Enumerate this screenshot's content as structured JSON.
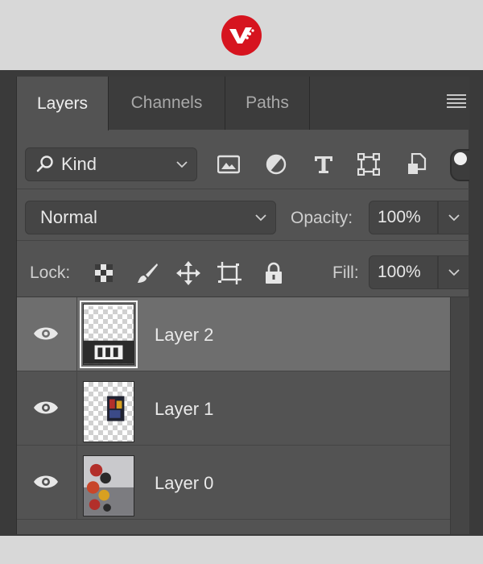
{
  "tabs": [
    {
      "label": "Layers",
      "active": true
    },
    {
      "label": "Channels",
      "active": false
    },
    {
      "label": "Paths",
      "active": false
    }
  ],
  "filter": {
    "kind_label": "Kind",
    "buttons": [
      "image-filter-icon",
      "adjustment-filter-icon",
      "type-filter-icon",
      "shape-filter-icon",
      "smart-object-filter-icon"
    ]
  },
  "blend": {
    "mode": "Normal",
    "opacity_label": "Opacity:",
    "opacity_value": "100%"
  },
  "lock": {
    "label": "Lock:",
    "fill_label": "Fill:",
    "fill_value": "100%",
    "buttons": [
      "lock-transparent-pixels-icon",
      "lock-image-pixels-icon",
      "lock-position-icon",
      "lock-artboard-icon",
      "lock-all-icon"
    ]
  },
  "layers": [
    {
      "name": "Layer 2",
      "selected": true,
      "visible": true
    },
    {
      "name": "Layer 1",
      "selected": false,
      "visible": true
    },
    {
      "name": "Layer 0",
      "selected": false,
      "visible": true
    }
  ],
  "colors": {
    "brand_logo": "#d6141f",
    "panel_bg": "#535353",
    "selected_row": "#6e6e6e"
  }
}
